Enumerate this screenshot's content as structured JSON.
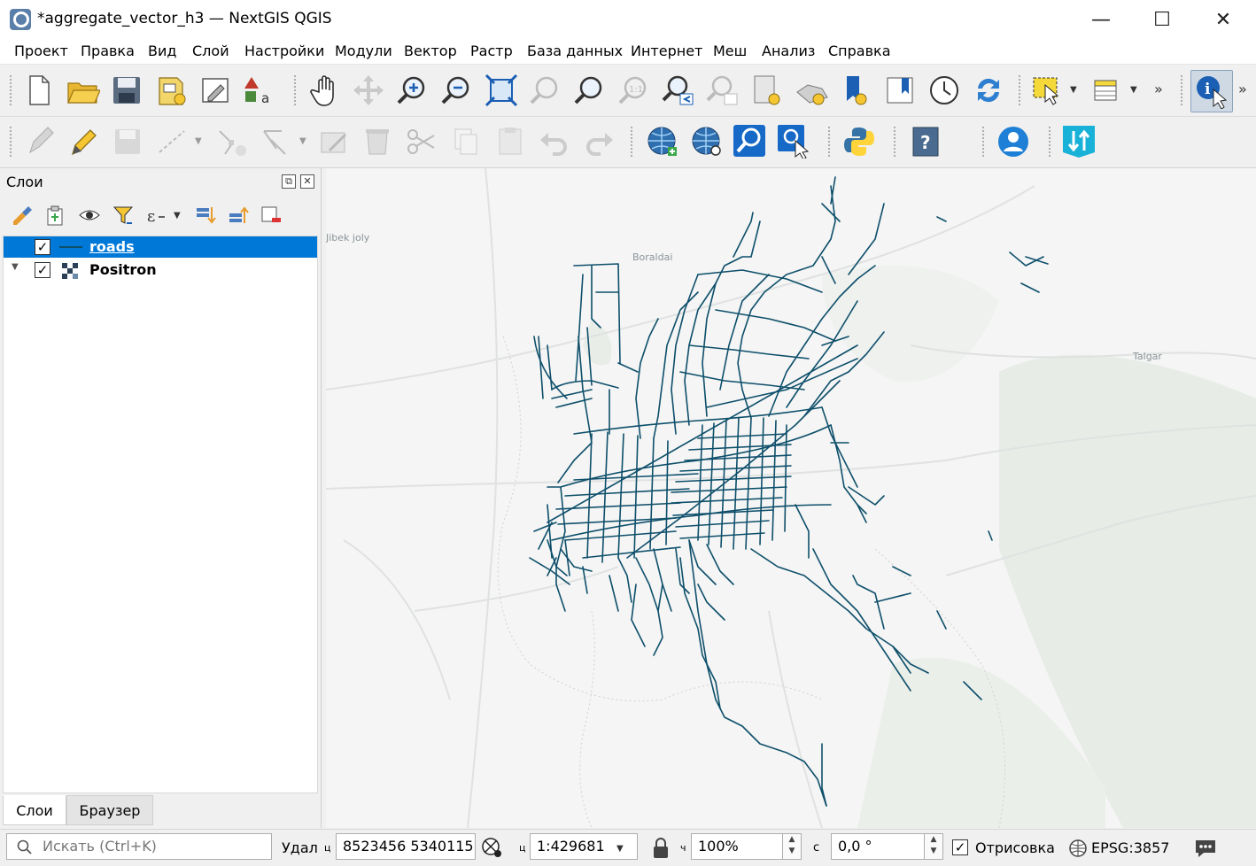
{
  "window": {
    "title": "*aggregate_vector_h3 — NextGIS QGIS",
    "minimize": "—",
    "maximize": "☐",
    "close": "✕"
  },
  "menu": [
    "Проект",
    "Правка",
    "Вид",
    "Слой",
    "Настройки",
    "Модули",
    "Вектор",
    "Растр",
    "База данных",
    "Интернет",
    "Меш",
    "Анализ",
    "Справка"
  ],
  "toolbar1_icons": [
    "new-project-icon",
    "open-project-icon",
    "save-project-icon",
    "new-print-layout-icon",
    "layout-manager-icon",
    "style-manager-icon",
    "pan-icon",
    "pan-to-selection-icon",
    "zoom-in-icon",
    "zoom-out-icon",
    "zoom-full-icon",
    "zoom-to-selection-icon",
    "zoom-to-layer-icon",
    "zoom-native-icon",
    "zoom-last-icon",
    "zoom-next-icon",
    "new-bookmark-icon",
    "show-bookmarks-icon",
    "new-spatial-bookmark-icon",
    "show-spatial-bookmarks-icon",
    "temporal-controller-icon",
    "refresh-icon",
    "select-features-icon",
    "attribute-table-icon",
    "identify-icon"
  ],
  "toolbar2_icons": [
    "current-edits-icon",
    "toggle-editing-icon",
    "save-edits-icon",
    "digitize-icon",
    "vertex-tool-icon",
    "advanced-digitize-icon",
    "modify-attributes-icon",
    "delete-selected-icon",
    "cut-features-icon",
    "copy-features-icon",
    "paste-features-icon",
    "undo-icon",
    "redo-icon",
    "nextgis-web-icon",
    "nextgis-search-icon",
    "quickmapservices-icon",
    "search-services-icon",
    "python-console-icon",
    "help-icon",
    "nextgis-account-icon",
    "nextgis-connect-icon"
  ],
  "layers_panel": {
    "title": "Слои",
    "float_btn": "⧉",
    "close_btn": "✕",
    "tools": [
      "open-layer-styling-icon",
      "add-group-icon",
      "manage-visibility-icon",
      "filter-legend-icon",
      "filter-expression-icon",
      "expand-all-icon",
      "collapse-all-icon",
      "remove-layer-icon"
    ],
    "layers": [
      {
        "name": "roads",
        "checked": "✓",
        "selected": true
      },
      {
        "name": "Positron",
        "checked": "✓",
        "selected": false
      }
    ],
    "tabs": [
      "Слои",
      "Браузер"
    ]
  },
  "map": {
    "place_labels": [
      "Jibek joly",
      "Boraldai",
      "Talgar"
    ],
    "road_color": "#0e4f6b"
  },
  "status": {
    "search_placeholder": "Искать (Ctrl+K)",
    "coord_label": "Удал",
    "coord_label_short": "ц",
    "coordinate": "8523456  5340115",
    "scale_label": "ц",
    "scale": "1:429681",
    "magnifier_label": "ч",
    "magnifier": "100%",
    "rotation_label": "с",
    "rotation": "0,0 °",
    "render_label": "Отрисовка",
    "render_checked": "✓",
    "crs": "EPSG:3857"
  }
}
